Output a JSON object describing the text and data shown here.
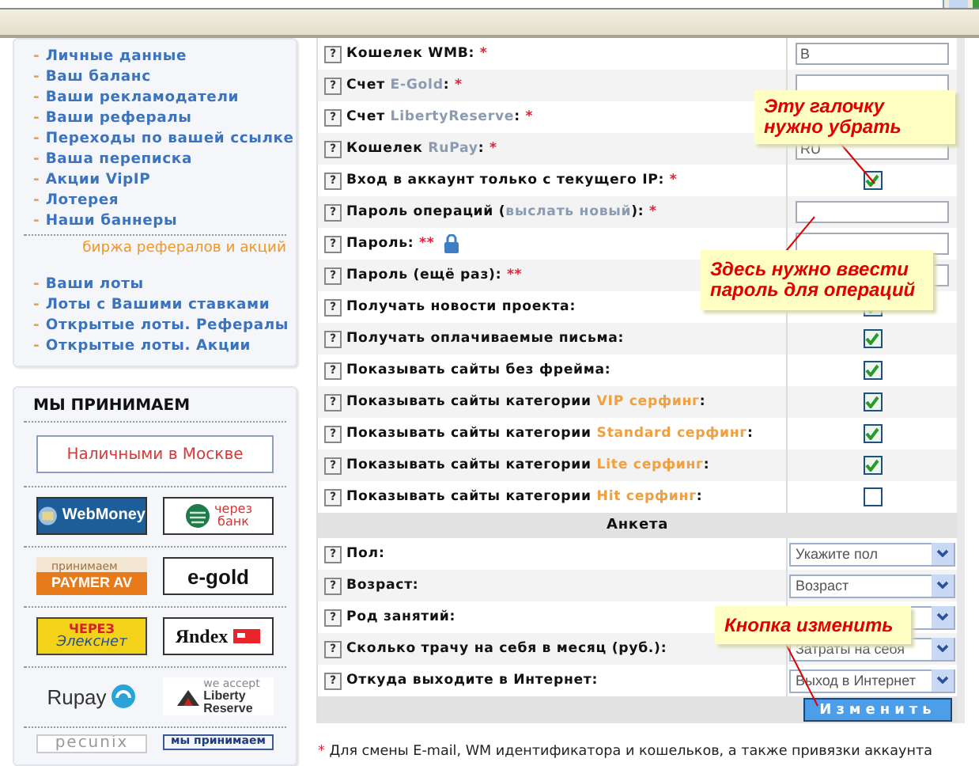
{
  "sidebar": {
    "menu": [
      {
        "marker": "-",
        "label": "Личные данные"
      },
      {
        "marker": "-",
        "label": "Ваш баланс"
      },
      {
        "marker": "-",
        "label": "Ваши рекламодатели"
      },
      {
        "marker": "-",
        "label": "Ваши рефералы"
      },
      {
        "marker": "-",
        "label": "Переходы по вашей ссылке"
      },
      {
        "marker": "-",
        "label": "Ваша переписка"
      },
      {
        "marker": "-",
        "label": "Акции VipIP"
      },
      {
        "marker": "-",
        "label": "Лотерея"
      },
      {
        "marker": "-",
        "label": "Наши баннеры"
      }
    ],
    "section_title": "биржа рефералов и акций",
    "menu_2": [
      {
        "marker": "-",
        "label": "Ваши лоты"
      },
      {
        "marker": "-",
        "label": "Лоты с Вашими ставками"
      },
      {
        "marker": "-",
        "label": "Открытые лоты. Рефералы"
      },
      {
        "marker": "-",
        "label": "Открытые лоты. Акции"
      }
    ],
    "payments_title": "МЫ ПРИНИМАЕМ",
    "cash_button": "Наличными в Москве",
    "logo_rows": [
      [
        {
          "kind": "webmoney",
          "lines": [
            "WebMoney"
          ]
        },
        {
          "kind": "bank",
          "lines": [
            "через",
            "банк"
          ]
        }
      ],
      [
        {
          "kind": "paymer",
          "lines": [
            "принимаем",
            "PAYMER AV"
          ]
        },
        {
          "kind": "egold",
          "lines": [
            "e-gold"
          ]
        }
      ],
      [
        {
          "kind": "eleksnet",
          "lines": [
            "ЧЕРЕЗ",
            "Элекснет"
          ]
        },
        {
          "kind": "yandex",
          "lines": [
            "Яndex"
          ]
        }
      ],
      [
        {
          "kind": "rupay",
          "lines": [
            "Rupay"
          ]
        },
        {
          "kind": "liberty",
          "lines": [
            "we accept",
            "Liberty",
            "Reserve"
          ]
        }
      ],
      [
        {
          "kind": "pecunix",
          "lines": [
            "pecunix"
          ]
        },
        {
          "kind": "banner",
          "lines": [
            "мы принимаем"
          ]
        }
      ]
    ]
  },
  "settings_rows": [
    {
      "help": "?",
      "label": [
        {
          "kind": "text",
          "text": "Кошелек WMB: "
        },
        {
          "kind": "required",
          "text": "*"
        }
      ],
      "kind": "text",
      "value": "B"
    },
    {
      "help": "?",
      "label": [
        {
          "kind": "text",
          "text": "Счет "
        },
        {
          "kind": "link",
          "text": "E-Gold"
        },
        {
          "kind": "text",
          "text": ": "
        },
        {
          "kind": "required",
          "text": "*"
        }
      ],
      "kind": "text"
    },
    {
      "help": "?",
      "label": [
        {
          "kind": "text",
          "text": "Счет "
        },
        {
          "kind": "link",
          "text": "LibertyReserve"
        },
        {
          "kind": "text",
          "text": ": "
        },
        {
          "kind": "required",
          "text": "*"
        }
      ]
    },
    {
      "help": "?",
      "label": [
        {
          "kind": "text",
          "text": "Кошелек "
        },
        {
          "kind": "link",
          "text": "RuPay"
        },
        {
          "kind": "text",
          "text": ": "
        },
        {
          "kind": "required",
          "text": "*"
        }
      ],
      "kind": "text",
      "value": "RU"
    },
    {
      "help": "?",
      "label": [
        {
          "kind": "text",
          "text": "Вход в аккаунт только с текущего IP: "
        },
        {
          "kind": "required",
          "text": "*"
        }
      ],
      "kind": "checkbox",
      "checked": true
    },
    {
      "help": "?",
      "label": [
        {
          "kind": "text",
          "text": "Пароль операций ("
        },
        {
          "kind": "link",
          "text": "выслать новый"
        },
        {
          "kind": "text",
          "text": "): "
        },
        {
          "kind": "required",
          "text": "*"
        }
      ],
      "kind": "text"
    },
    {
      "help": "?",
      "label": [
        {
          "kind": "text",
          "text": "Пароль: "
        },
        {
          "kind": "required",
          "text": "**"
        },
        {
          "kind": "lock"
        }
      ],
      "kind": "text"
    },
    {
      "help": "?",
      "label": [
        {
          "kind": "text",
          "text": "Пароль (ещё раз): "
        },
        {
          "kind": "required",
          "text": "**"
        }
      ],
      "kind": "text"
    },
    {
      "help": "?",
      "label": [
        {
          "kind": "text",
          "text": "Получать новости проекта:"
        }
      ],
      "kind": "checkbox",
      "checked": true
    },
    {
      "help": "?",
      "label": [
        {
          "kind": "text",
          "text": "Получать оплачиваемые письма:"
        }
      ],
      "kind": "checkbox",
      "checked": true
    },
    {
      "help": "?",
      "label": [
        {
          "kind": "text",
          "text": "Показывать сайты без фрейма:"
        }
      ],
      "kind": "checkbox",
      "checked": true
    },
    {
      "help": "?",
      "label": [
        {
          "kind": "text",
          "text": "Показывать сайты категории "
        },
        {
          "kind": "accent",
          "text": "VIP серфинг"
        },
        {
          "kind": "text",
          "text": ":"
        }
      ],
      "kind": "checkbox",
      "checked": true
    },
    {
      "help": "?",
      "label": [
        {
          "kind": "text",
          "text": "Показывать сайты категории "
        },
        {
          "kind": "accent",
          "text": "Standard серфинг"
        },
        {
          "kind": "text",
          "text": ":"
        }
      ],
      "kind": "checkbox",
      "checked": true
    },
    {
      "help": "?",
      "label": [
        {
          "kind": "text",
          "text": "Показывать сайты категории "
        },
        {
          "kind": "accent",
          "text": "Lite серфинг"
        },
        {
          "kind": "text",
          "text": ":"
        }
      ],
      "kind": "checkbox",
      "checked": true
    },
    {
      "help": "?",
      "label": [
        {
          "kind": "text",
          "text": "Показывать сайты категории "
        },
        {
          "kind": "accent",
          "text": "Hit серфинг"
        },
        {
          "kind": "text",
          "text": ":"
        }
      ],
      "kind": "checkbox",
      "checked": false
    }
  ],
  "survey": {
    "title": "Анкета",
    "rows": [
      {
        "help": "?",
        "label": [
          {
            "kind": "text",
            "text": "Пол:"
          }
        ],
        "kind": "select",
        "value": "Укажите пол"
      },
      {
        "help": "?",
        "label": [
          {
            "kind": "text",
            "text": "Возраст:"
          }
        ],
        "kind": "select",
        "value": "Возраст"
      },
      {
        "help": "?",
        "label": [
          {
            "kind": "text",
            "text": "Род занятий:"
          }
        ],
        "kind": "select"
      },
      {
        "help": "?",
        "label": [
          {
            "kind": "text",
            "text": "Сколько трачу на себя в месяц (руб.):"
          }
        ],
        "kind": "select",
        "value": "Затраты на себя"
      },
      {
        "help": "?",
        "label": [
          {
            "kind": "text",
            "text": "Откуда выходите в Интернет:"
          }
        ],
        "kind": "select",
        "value": "Выход в Интернет"
      }
    ]
  },
  "submit_button": "Изменить",
  "footnote": {
    "mark": "*",
    "text": "Для смены E-mail, WM идентификатора и кошельков, а также привязки аккаунта"
  },
  "callouts": [
    {
      "text": "Эту галочку нужно убрать"
    },
    {
      "text": "Здесь нужно ввести пароль для операций"
    },
    {
      "text": "Кнопка изменить"
    }
  ]
}
